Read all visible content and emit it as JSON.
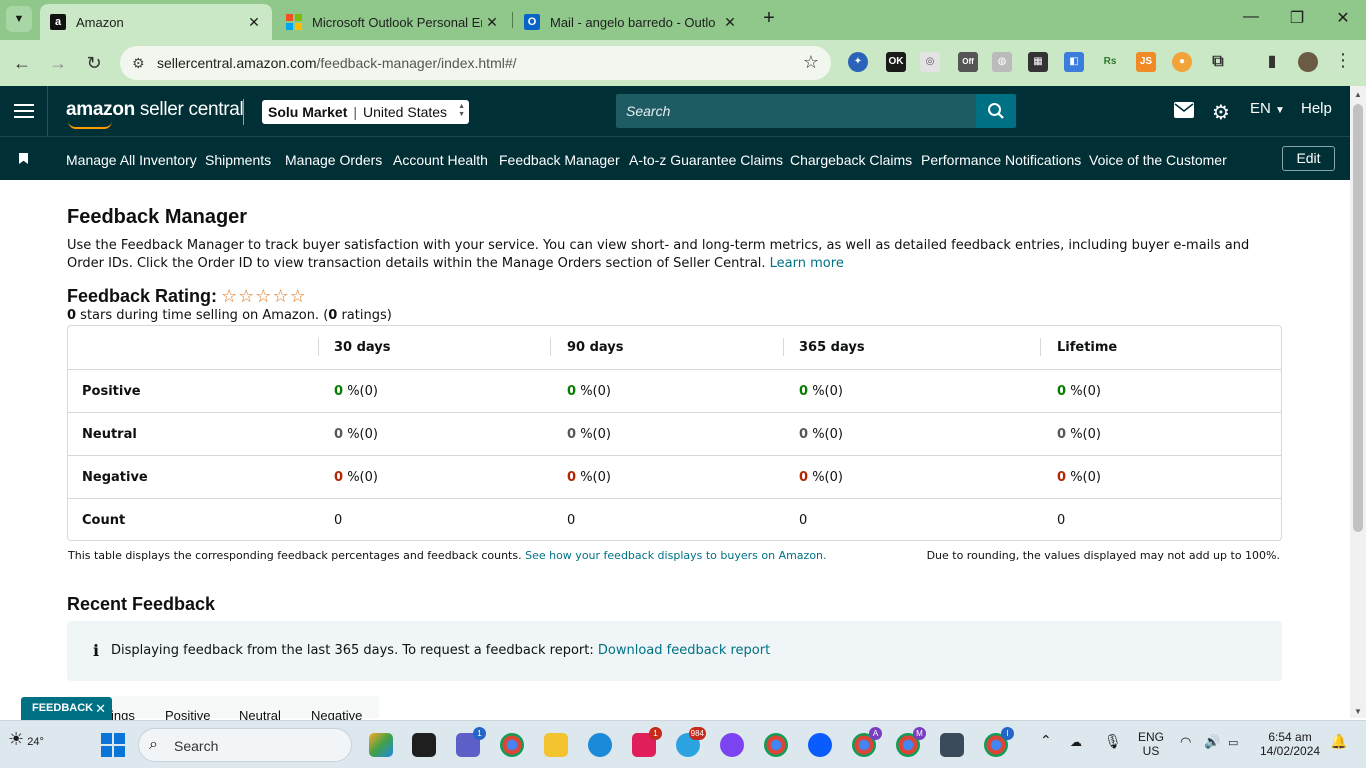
{
  "browser": {
    "tabs": [
      {
        "title": "Amazon",
        "icon": "amazon-icon"
      },
      {
        "title": "Microsoft Outlook Personal Em",
        "icon": "microsoft-icon"
      },
      {
        "title": "Mail - angelo barredo - Outlo",
        "icon": "outlook-icon"
      }
    ],
    "url_host": "sellercentral.amazon.com",
    "url_path": "/feedback-manager/index.html#/"
  },
  "header": {
    "logo_bold": "amazon",
    "logo_rest": " seller central",
    "store_name": "Solu Market",
    "store_region": "United States",
    "search_placeholder": "Search",
    "language": "EN",
    "help": "Help"
  },
  "nav": {
    "items": [
      "Manage All Inventory",
      "Shipments",
      "Manage Orders",
      "Account Health",
      "Feedback Manager",
      "A-to-z Guarantee Claims",
      "Chargeback Claims",
      "Performance Notifications",
      "Voice of the Customer"
    ],
    "edit": "Edit"
  },
  "page": {
    "title": "Feedback Manager",
    "description": "Use the Feedback Manager to track buyer satisfaction with your service. You can view short- and long-term metrics, as well as detailed feedback entries, including buyer e-mails and Order IDs. Click the Order ID to view transaction details within the Manage Orders section of Seller Central.",
    "learn_more": "Learn more",
    "rating_label": "Feedback Rating:",
    "stars_value": "0",
    "stars_text": " stars during time selling on Amazon. (",
    "ratings_count": "0",
    "ratings_text": " ratings)"
  },
  "table": {
    "columns": [
      "30 days",
      "90 days",
      "365 days",
      "Lifetime"
    ],
    "rows": [
      {
        "label": "Positive",
        "values": [
          "0",
          "0",
          "0",
          "0"
        ],
        "counts": [
          "%(0)",
          "%(0)",
          "%(0)",
          "%(0)"
        ]
      },
      {
        "label": "Neutral",
        "values": [
          "0",
          "0",
          "0",
          "0"
        ],
        "counts": [
          "%(0)",
          "%(0)",
          "%(0)",
          "%(0)"
        ]
      },
      {
        "label": "Negative",
        "values": [
          "0",
          "0",
          "0",
          "0"
        ],
        "counts": [
          "%(0)",
          "%(0)",
          "%(0)",
          "%(0)"
        ]
      },
      {
        "label": "Count",
        "values": [
          "0",
          "0",
          "0",
          "0"
        ]
      }
    ],
    "note": "This table displays the corresponding feedback percentages and feedback counts.",
    "note_link": "See how your feedback displays to buyers on Amazon.",
    "rounding_note": "Due to rounding, the values displayed may not add up to 100%."
  },
  "recent": {
    "title": "Recent Feedback",
    "info": "Displaying feedback from the last 365 days. To request a feedback report:",
    "info_link": "Download feedback report",
    "tabs": [
      "ings",
      "Positive",
      "Neutral",
      "Negative"
    ]
  },
  "feedback_tag": "FEEDBACK",
  "taskbar": {
    "temperature": "24°",
    "search": "Search",
    "lang_top": "ENG",
    "lang_bottom": "US",
    "time": "6:54 am",
    "date": "14/02/2024",
    "badges": {
      "teams": "1",
      "slack": "1",
      "telegram": "984",
      "chrome_a": "A",
      "chrome_m": "M",
      "chrome_i": "I"
    }
  }
}
